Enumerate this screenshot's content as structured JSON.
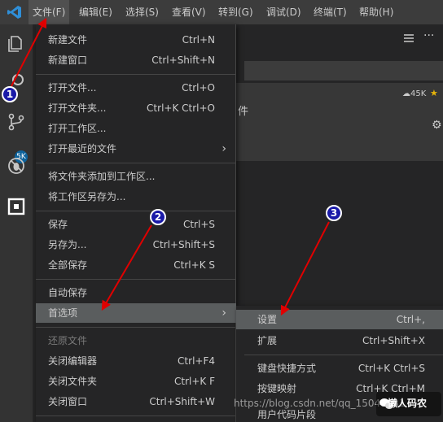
{
  "menubar": {
    "items": [
      "文件(F)",
      "编辑(E)",
      "选择(S)",
      "查看(V)",
      "转到(G)",
      "调试(D)",
      "终端(T)",
      "帮助(H)"
    ]
  },
  "activity": {
    "badge": "5K"
  },
  "ext_panel": {
    "downloads": "45K",
    "card_text": "件"
  },
  "file_menu": {
    "items": [
      {
        "label": "新建文件",
        "kb": "Ctrl+N"
      },
      {
        "label": "新建窗口",
        "kb": "Ctrl+Shift+N"
      },
      {
        "label": "打开文件...",
        "kb": "Ctrl+O"
      },
      {
        "label": "打开文件夹...",
        "kb": "Ctrl+K Ctrl+O"
      },
      {
        "label": "打开工作区...",
        "kb": ""
      },
      {
        "label": "打开最近的文件",
        "kb": ""
      },
      {
        "label": "将文件夹添加到工作区...",
        "kb": ""
      },
      {
        "label": "将工作区另存为...",
        "kb": ""
      },
      {
        "label": "保存",
        "kb": "Ctrl+S"
      },
      {
        "label": "另存为...",
        "kb": "Ctrl+Shift+S"
      },
      {
        "label": "全部保存",
        "kb": "Ctrl+K S"
      },
      {
        "label": "自动保存",
        "kb": ""
      },
      {
        "label": "首选项",
        "kb": ""
      },
      {
        "label": "还原文件",
        "kb": ""
      },
      {
        "label": "关闭编辑器",
        "kb": "Ctrl+F4"
      },
      {
        "label": "关闭文件夹",
        "kb": "Ctrl+K F"
      },
      {
        "label": "关闭窗口",
        "kb": "Ctrl+Shift+W"
      }
    ]
  },
  "pref_menu": {
    "items": [
      {
        "label": "设置",
        "kb": "Ctrl+,"
      },
      {
        "label": "扩展",
        "kb": "Ctrl+Shift+X"
      },
      {
        "label": "键盘快捷方式",
        "kb": "Ctrl+K Ctrl+S"
      },
      {
        "label": "按键映射",
        "kb": "Ctrl+K Ctrl+M"
      },
      {
        "label": "用户代码片段",
        "kb": ""
      }
    ]
  },
  "annotations": {
    "step1": "1",
    "step2": "2",
    "step3": "3",
    "arrow_color": "#e00000"
  },
  "watermark": {
    "url": "https://blog.csdn.net/qq_15041931",
    "brand": "懒人码农"
  }
}
